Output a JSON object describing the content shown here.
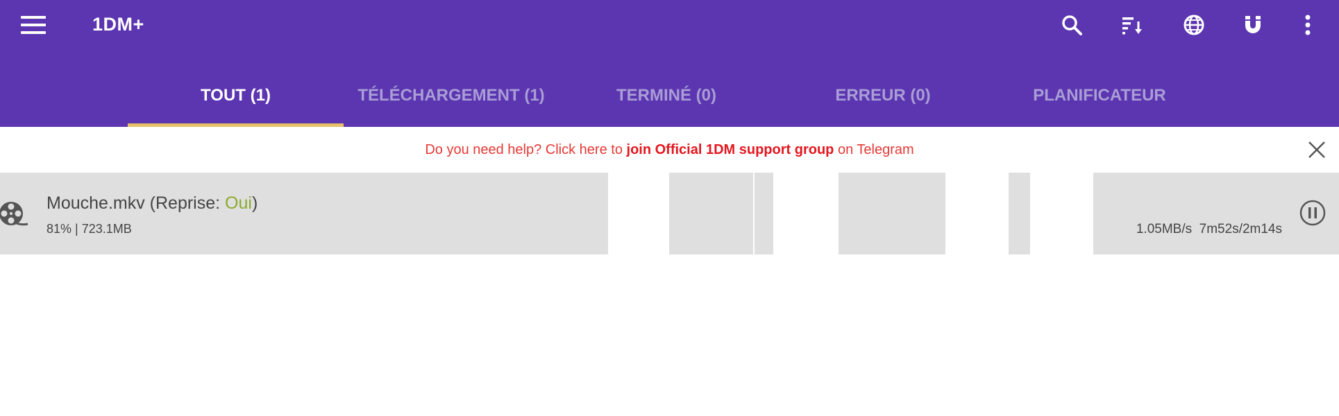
{
  "app": {
    "title": "1DM+"
  },
  "toolbar": {
    "actions": [
      {
        "icon": "search-icon"
      },
      {
        "icon": "sort-icon"
      },
      {
        "icon": "globe-icon"
      },
      {
        "icon": "magnet-icon"
      },
      {
        "icon": "more-vert-icon"
      }
    ]
  },
  "tabs": [
    {
      "label": "TOUT (1)",
      "active": true
    },
    {
      "label": "TÉLÉCHARGEMENT (1)",
      "active": false
    },
    {
      "label": "TERMINÉ (0)",
      "active": false
    },
    {
      "label": "ERREUR (0)",
      "active": false
    },
    {
      "label": "PLANIFICATEUR",
      "active": false
    }
  ],
  "help_banner": {
    "prefix": "Do you need help? Click here to ",
    "link": "join Official 1DM support group",
    "suffix": " on Telegram"
  },
  "downloads": [
    {
      "name": "Mouche.mkv",
      "resume_label": " (Reprise: ",
      "resume_value": "Oui",
      "resume_close": ")",
      "info": "81% | 723.1MB",
      "speed": "1.05MB/s  7m52s/2m14s",
      "progress": 0.81
    }
  ],
  "colors": {
    "accent": "#5c36b0",
    "indicator": "#e7c06a",
    "help_text": "#e53935",
    "resume_yes": "#8bab2d",
    "row_bg": "#dfdfdf"
  }
}
